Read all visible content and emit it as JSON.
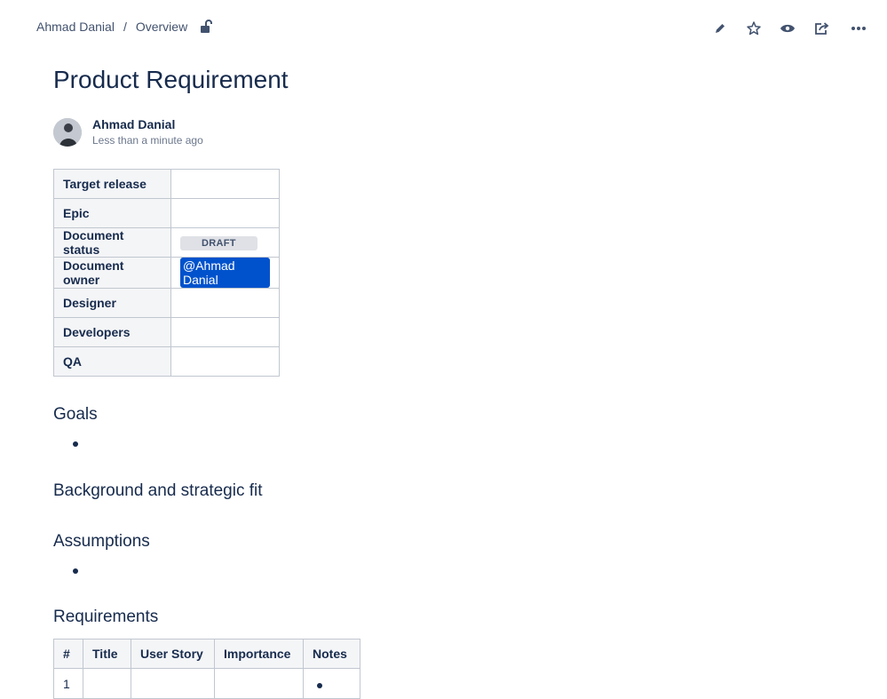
{
  "breadcrumb": {
    "items": [
      "Ahmad Danial",
      "Overview"
    ],
    "separator": "/"
  },
  "page": {
    "title": "Product Requirement",
    "author": "Ahmad Danial",
    "updated": "Less than a minute ago"
  },
  "properties": {
    "rows": [
      {
        "label": "Target release",
        "value": ""
      },
      {
        "label": "Epic",
        "value": ""
      },
      {
        "label": "Document status",
        "value": "DRAFT"
      },
      {
        "label": "Document owner",
        "value": "@Ahmad Danial"
      },
      {
        "label": "Designer",
        "value": ""
      },
      {
        "label": "Developers",
        "value": ""
      },
      {
        "label": "QA",
        "value": ""
      }
    ]
  },
  "sections": {
    "goals": "Goals",
    "background": "Background and strategic fit",
    "assumptions": "Assumptions",
    "requirements": "Requirements"
  },
  "requirements": {
    "headers": [
      "#",
      "Title",
      "User Story",
      "Importance",
      "Notes"
    ],
    "rows": [
      {
        "num": "1",
        "title": "",
        "story": "",
        "importance": "",
        "notes": ""
      }
    ]
  },
  "toolbar": {
    "icons": [
      "edit-icon",
      "star-icon",
      "watch-icon",
      "share-icon",
      "more-icon"
    ]
  },
  "colors": {
    "text": "#172b4d",
    "link": "#42526e",
    "mention": "#0052cc",
    "lozenge": "#dfe1e6",
    "header_bg": "#f4f5f7"
  }
}
